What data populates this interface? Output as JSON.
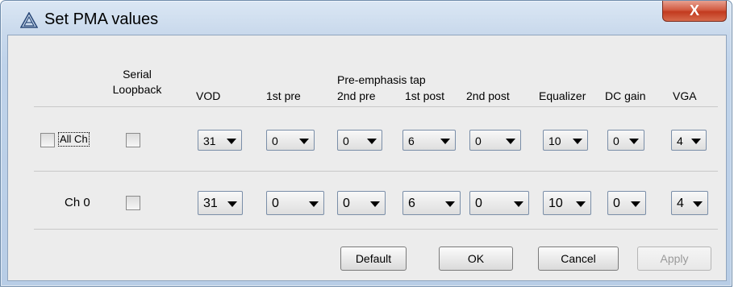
{
  "window": {
    "title": "Set PMA values",
    "close_label": "X"
  },
  "headers": {
    "serial_loopback_line1": "Serial",
    "serial_loopback_line2": "Loopback",
    "vod": "VOD",
    "first_pre": "1st pre",
    "pre_emphasis_tap": "Pre-emphasis tap",
    "second_pre": "2nd pre",
    "first_post": "1st post",
    "second_post": "2nd post",
    "equalizer": "Equalizer",
    "dc_gain": "DC gain",
    "vga": "VGA"
  },
  "rows": [
    {
      "label": "All Ch",
      "label_checked": false,
      "serial_loopback": false,
      "vod": "31",
      "first_pre": "0",
      "second_pre": "0",
      "first_post": "6",
      "second_post": "0",
      "equalizer": "10",
      "dc_gain": "0",
      "vga": "4"
    },
    {
      "label": "Ch 0",
      "serial_loopback": false,
      "vod": "31",
      "first_pre": "0",
      "second_pre": "0",
      "first_post": "6",
      "second_post": "0",
      "equalizer": "10",
      "dc_gain": "0",
      "vga": "4"
    }
  ],
  "buttons": {
    "default": "Default",
    "ok": "OK",
    "cancel": "Cancel",
    "apply": "Apply"
  }
}
